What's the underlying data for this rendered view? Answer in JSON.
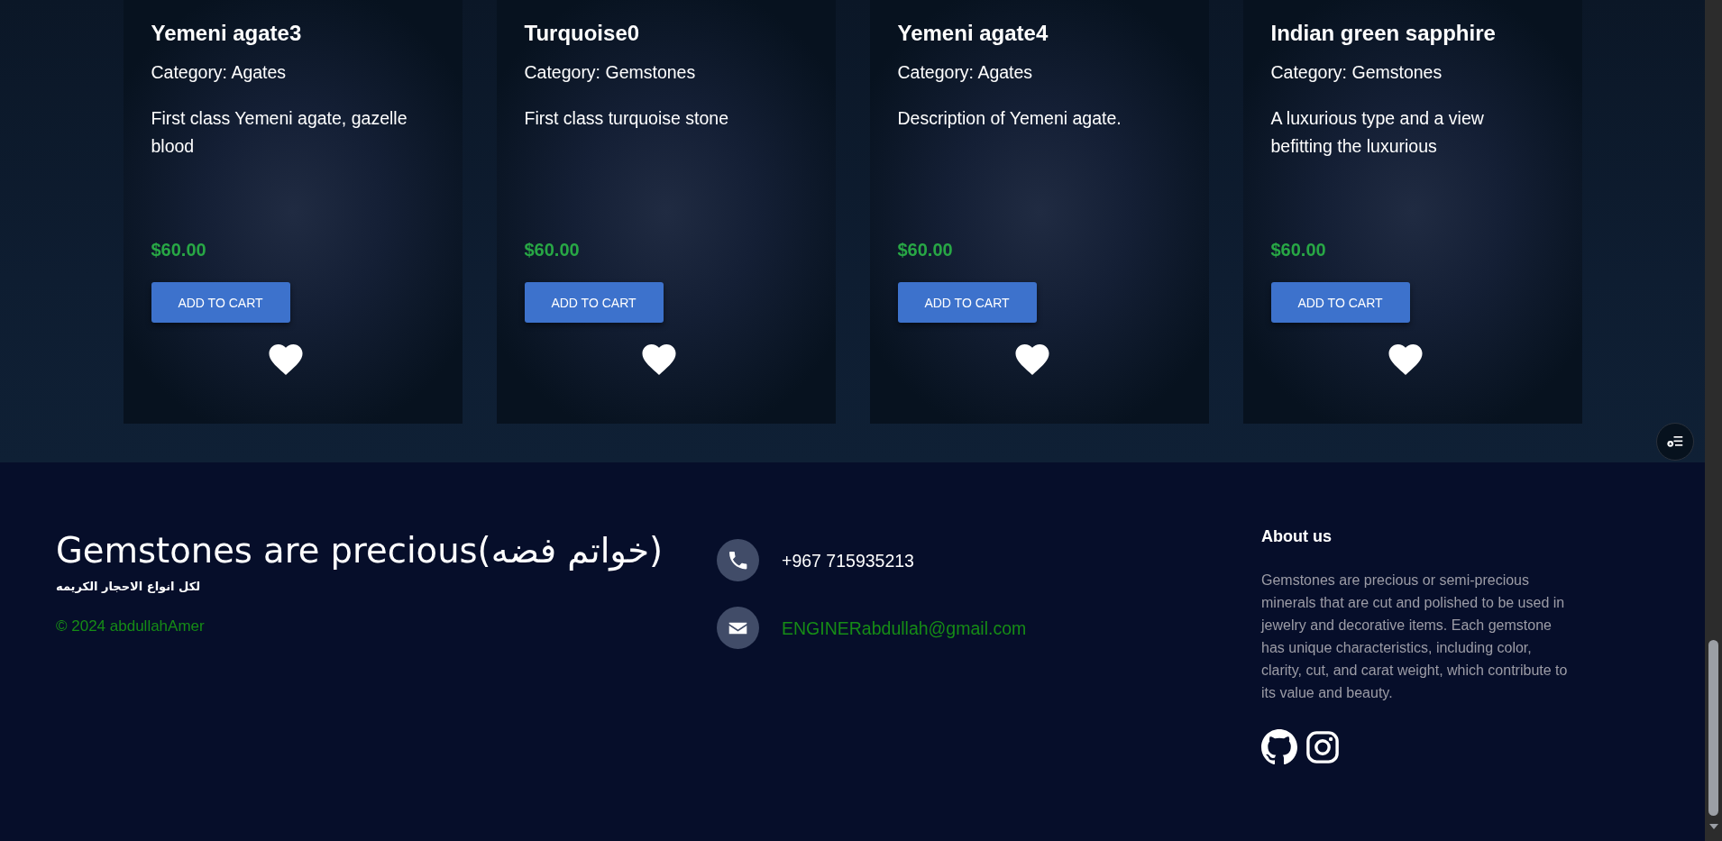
{
  "products": [
    {
      "name": "Yemeni agate3",
      "category": "Category: Agates",
      "description": "First class Yemeni agate, gazelle blood",
      "price": "$60.00",
      "button": "ADD TO CART"
    },
    {
      "name": "Turquoise0",
      "category": "Category: Gemstones",
      "description": "First class turquoise stone",
      "price": "$60.00",
      "button": "ADD TO CART"
    },
    {
      "name": "Yemeni agate4",
      "category": "Category: Agates",
      "description": "Description of Yemeni agate.",
      "price": "$60.00",
      "button": "ADD TO CART"
    },
    {
      "name": "Indian green sapphire",
      "category": "Category: Gemstones",
      "description": "A luxurious type and a view befitting the luxurious",
      "price": "$60.00",
      "button": "ADD TO CART"
    }
  ],
  "footer": {
    "title": "Gemstones are precious(خواتم فضه)",
    "subtitle": "لكل انواع الاحجار الكريمه",
    "copyright": "© 2024 abdullahAmer",
    "contacts": [
      {
        "kind": "phone",
        "text": "+967 715935213"
      },
      {
        "kind": "email",
        "text": "ENGINERabdullah@gmail.com"
      }
    ],
    "about": {
      "heading": "About us",
      "text": "Gemstones are precious or semi-precious minerals that are cut and polished to be used in jewelry and decorative items. Each gemstone has unique characteristics, including color, clarity, cut, and carat weight, which contribute to its value and beauty.",
      "social": [
        {
          "kind": "github"
        },
        {
          "kind": "instagram"
        }
      ]
    }
  }
}
